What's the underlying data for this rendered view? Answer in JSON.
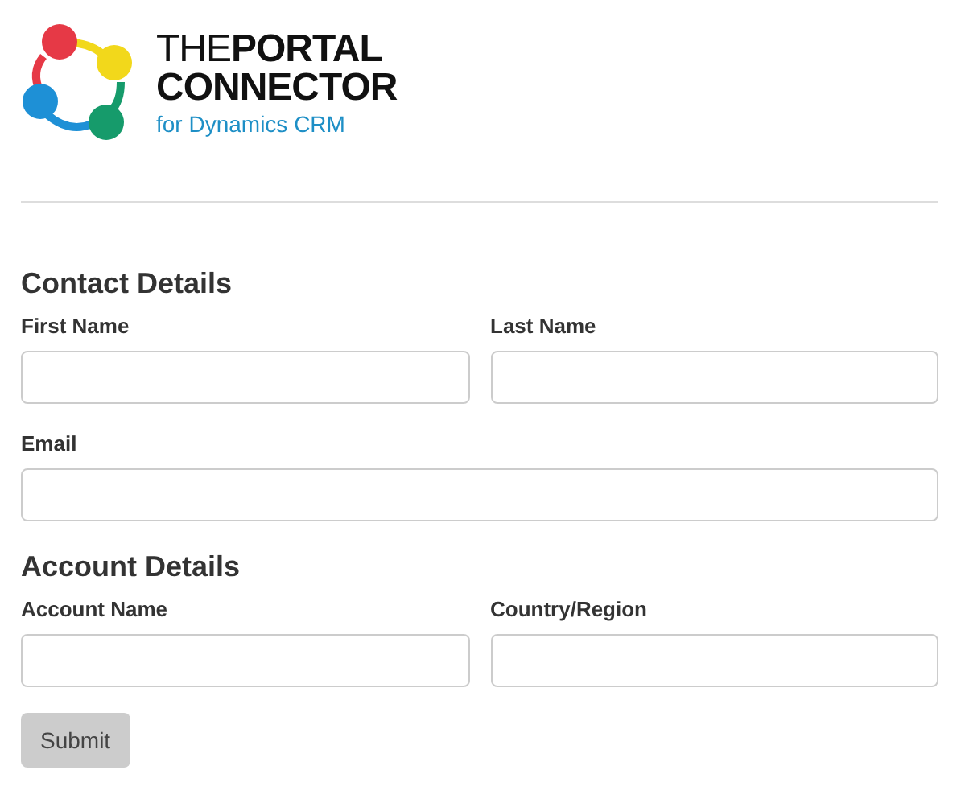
{
  "logo": {
    "line_1": "THE**PORTAL**",
    "line_2": "CONNECTOR",
    "tagline": "for Dynamics CRM"
  },
  "sections": [
    {
      "title": "Contact Details",
      "rows": [
        [
          {
            "label": "First Name"
          },
          {
            "label": "Last Name"
          }
        ],
        [
          {
            "label": "Email"
          }
        ]
      ]
    },
    {
      "title": "Account Details",
      "rows": [
        [
          {
            "label": "Account Name"
          },
          {
            "label": "Country/Region"
          }
        ]
      ]
    }
  ],
  "submit": {
    "label": "Submit",
    "disabled": true
  }
}
